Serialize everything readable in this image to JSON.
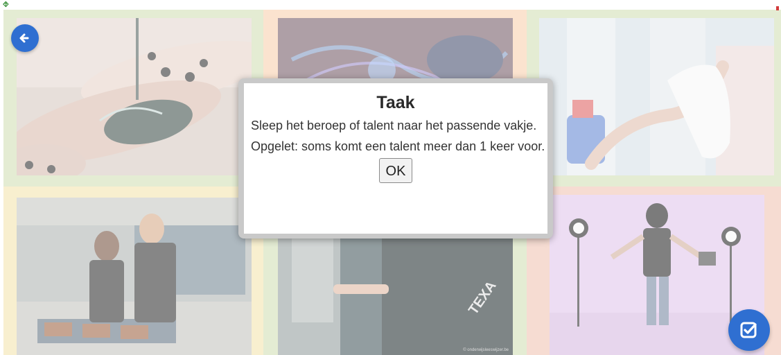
{
  "colors": {
    "accent": "#2f6fd1",
    "tile_green": "#e4ecd3",
    "tile_peach": "#fbe3cf",
    "tile_yellow": "#f8efcf",
    "tile_pink": "#f6dcd2"
  },
  "toolbar": {
    "back_icon": "arrow-left-icon",
    "check_icon": "check-square-icon"
  },
  "tiles": [
    {
      "name": "nail-art",
      "bg": "#e4ecd3"
    },
    {
      "name": "welding",
      "bg": "#fbe3cf"
    },
    {
      "name": "cleaning",
      "bg": "#e4ecd3"
    },
    {
      "name": "coffee-tasting",
      "bg": "#f8efcf"
    },
    {
      "name": "car-mechanic",
      "bg": "#e4ecd3"
    },
    {
      "name": "performer",
      "bg": "#f6dcd2"
    }
  ],
  "photo_caption": "© onderwijsleeswijzer.be",
  "modal": {
    "title": "Taak",
    "line1": "Sleep het beroep of talent naar het passende vakje.",
    "line2": "Opgelet: soms komt een talent meer dan 1 keer voor.",
    "ok_label": "OK"
  }
}
